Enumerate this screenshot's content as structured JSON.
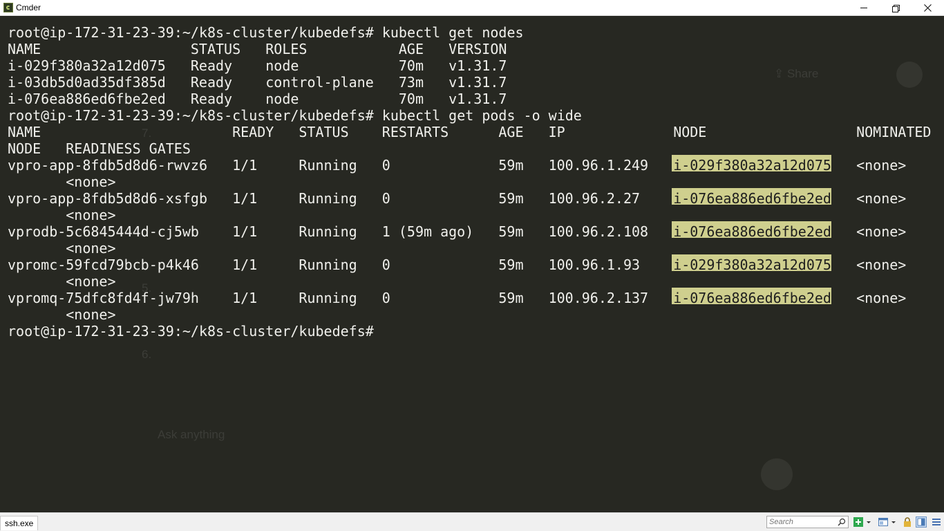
{
  "window": {
    "title": "Cmder",
    "minimize_icon": "minimize-icon",
    "restore_icon": "restore-icon",
    "close_icon": "close-icon"
  },
  "terminal": {
    "lines": [
      {
        "cells": [
          {
            "col": 0,
            "text": "root@ip-172-31-23-39:~/k8s-cluster/kubedefs# kubectl get nodes"
          }
        ]
      },
      {
        "cells": [
          {
            "col": 0,
            "text": "NAME"
          },
          {
            "col": 22,
            "text": "STATUS"
          },
          {
            "col": 31,
            "text": "ROLES"
          },
          {
            "col": 47,
            "text": "AGE"
          },
          {
            "col": 53,
            "text": "VERSION"
          }
        ]
      },
      {
        "cells": [
          {
            "col": 0,
            "text": "i-029f380a32a12d075"
          },
          {
            "col": 22,
            "text": "Ready"
          },
          {
            "col": 31,
            "text": "node"
          },
          {
            "col": 47,
            "text": "70m"
          },
          {
            "col": 53,
            "text": "v1.31.7"
          }
        ]
      },
      {
        "cells": [
          {
            "col": 0,
            "text": "i-03db5d0ad35df385d"
          },
          {
            "col": 22,
            "text": "Ready"
          },
          {
            "col": 31,
            "text": "control-plane"
          },
          {
            "col": 47,
            "text": "73m"
          },
          {
            "col": 53,
            "text": "v1.31.7"
          }
        ]
      },
      {
        "cells": [
          {
            "col": 0,
            "text": "i-076ea886ed6fbe2ed"
          },
          {
            "col": 22,
            "text": "Ready"
          },
          {
            "col": 31,
            "text": "node"
          },
          {
            "col": 47,
            "text": "70m"
          },
          {
            "col": 53,
            "text": "v1.31.7"
          }
        ]
      },
      {
        "cells": [
          {
            "col": 0,
            "text": "root@ip-172-31-23-39:~/k8s-cluster/kubedefs# kubectl get pods -o wide"
          }
        ]
      },
      {
        "cells": [
          {
            "col": 0,
            "text": "NAME"
          },
          {
            "col": 27,
            "text": "READY"
          },
          {
            "col": 35,
            "text": "STATUS"
          },
          {
            "col": 45,
            "text": "RESTARTS"
          },
          {
            "col": 59,
            "text": "AGE"
          },
          {
            "col": 65,
            "text": "IP"
          },
          {
            "col": 80,
            "text": "NODE"
          },
          {
            "col": 102,
            "text": "NOMINATED"
          }
        ]
      },
      {
        "cells": [
          {
            "col": 0,
            "text": "NODE"
          },
          {
            "col": 7,
            "text": "READINESS GATES"
          }
        ]
      },
      {
        "cells": [
          {
            "col": 0,
            "text": "vpro-app-8fdb5d8d6-rwvz6"
          },
          {
            "col": 27,
            "text": "1/1"
          },
          {
            "col": 35,
            "text": "Running"
          },
          {
            "col": 45,
            "text": "0"
          },
          {
            "col": 59,
            "text": "59m"
          },
          {
            "col": 65,
            "text": "100.96.1.249"
          },
          {
            "col": 80,
            "text": "i-029f380a32a12d075",
            "hl": true
          },
          {
            "col": 102,
            "text": "<none>"
          }
        ]
      },
      {
        "cells": [
          {
            "col": 7,
            "text": "<none>"
          }
        ]
      },
      {
        "cells": [
          {
            "col": 0,
            "text": "vpro-app-8fdb5d8d6-xsfgb"
          },
          {
            "col": 27,
            "text": "1/1"
          },
          {
            "col": 35,
            "text": "Running"
          },
          {
            "col": 45,
            "text": "0"
          },
          {
            "col": 59,
            "text": "59m"
          },
          {
            "col": 65,
            "text": "100.96.2.27"
          },
          {
            "col": 80,
            "text": "i-076ea886ed6fbe2ed",
            "hl": true
          },
          {
            "col": 102,
            "text": "<none>"
          }
        ]
      },
      {
        "cells": [
          {
            "col": 7,
            "text": "<none>"
          }
        ]
      },
      {
        "cells": [
          {
            "col": 0,
            "text": "vprodb-5c6845444d-cj5wb"
          },
          {
            "col": 27,
            "text": "1/1"
          },
          {
            "col": 35,
            "text": "Running"
          },
          {
            "col": 45,
            "text": "1 (59m ago)"
          },
          {
            "col": 59,
            "text": "59m"
          },
          {
            "col": 65,
            "text": "100.96.2.108"
          },
          {
            "col": 80,
            "text": "i-076ea886ed6fbe2ed",
            "hl": true
          },
          {
            "col": 102,
            "text": "<none>"
          }
        ]
      },
      {
        "cells": [
          {
            "col": 7,
            "text": "<none>"
          }
        ]
      },
      {
        "cells": [
          {
            "col": 0,
            "text": "vpromc-59fcd79bcb-p4k46"
          },
          {
            "col": 27,
            "text": "1/1"
          },
          {
            "col": 35,
            "text": "Running"
          },
          {
            "col": 45,
            "text": "0"
          },
          {
            "col": 59,
            "text": "59m"
          },
          {
            "col": 65,
            "text": "100.96.1.93"
          },
          {
            "col": 80,
            "text": "i-029f380a32a12d075",
            "hl": true
          },
          {
            "col": 102,
            "text": "<none>"
          }
        ]
      },
      {
        "cells": [
          {
            "col": 7,
            "text": "<none>"
          }
        ]
      },
      {
        "cells": [
          {
            "col": 0,
            "text": "vpromq-75dfc8fd4f-jw79h"
          },
          {
            "col": 27,
            "text": "1/1"
          },
          {
            "col": 35,
            "text": "Running"
          },
          {
            "col": 45,
            "text": "0"
          },
          {
            "col": 59,
            "text": "59m"
          },
          {
            "col": 65,
            "text": "100.96.2.137"
          },
          {
            "col": 80,
            "text": "i-076ea886ed6fbe2ed",
            "hl": true
          },
          {
            "col": 102,
            "text": "<none>"
          }
        ]
      },
      {
        "cells": [
          {
            "col": 7,
            "text": "<none>"
          }
        ]
      },
      {
        "cells": [
          {
            "col": 0,
            "text": "root@ip-172-31-23-39:~/k8s-cluster/kubedefs#"
          }
        ]
      }
    ],
    "colors": {
      "background": "#272822",
      "foreground": "#f0f0ec",
      "highlight": "#cfcf8e"
    }
  },
  "statusbar": {
    "process_label": "ssh.exe",
    "search_placeholder": "Search",
    "search_icon": "search-icon",
    "new_console_icon": "plus-icon",
    "layout_icon": "layout-icon",
    "lock_icon": "lock-icon",
    "window_icon": "window-icon",
    "menu_icon": "menu-icon"
  }
}
